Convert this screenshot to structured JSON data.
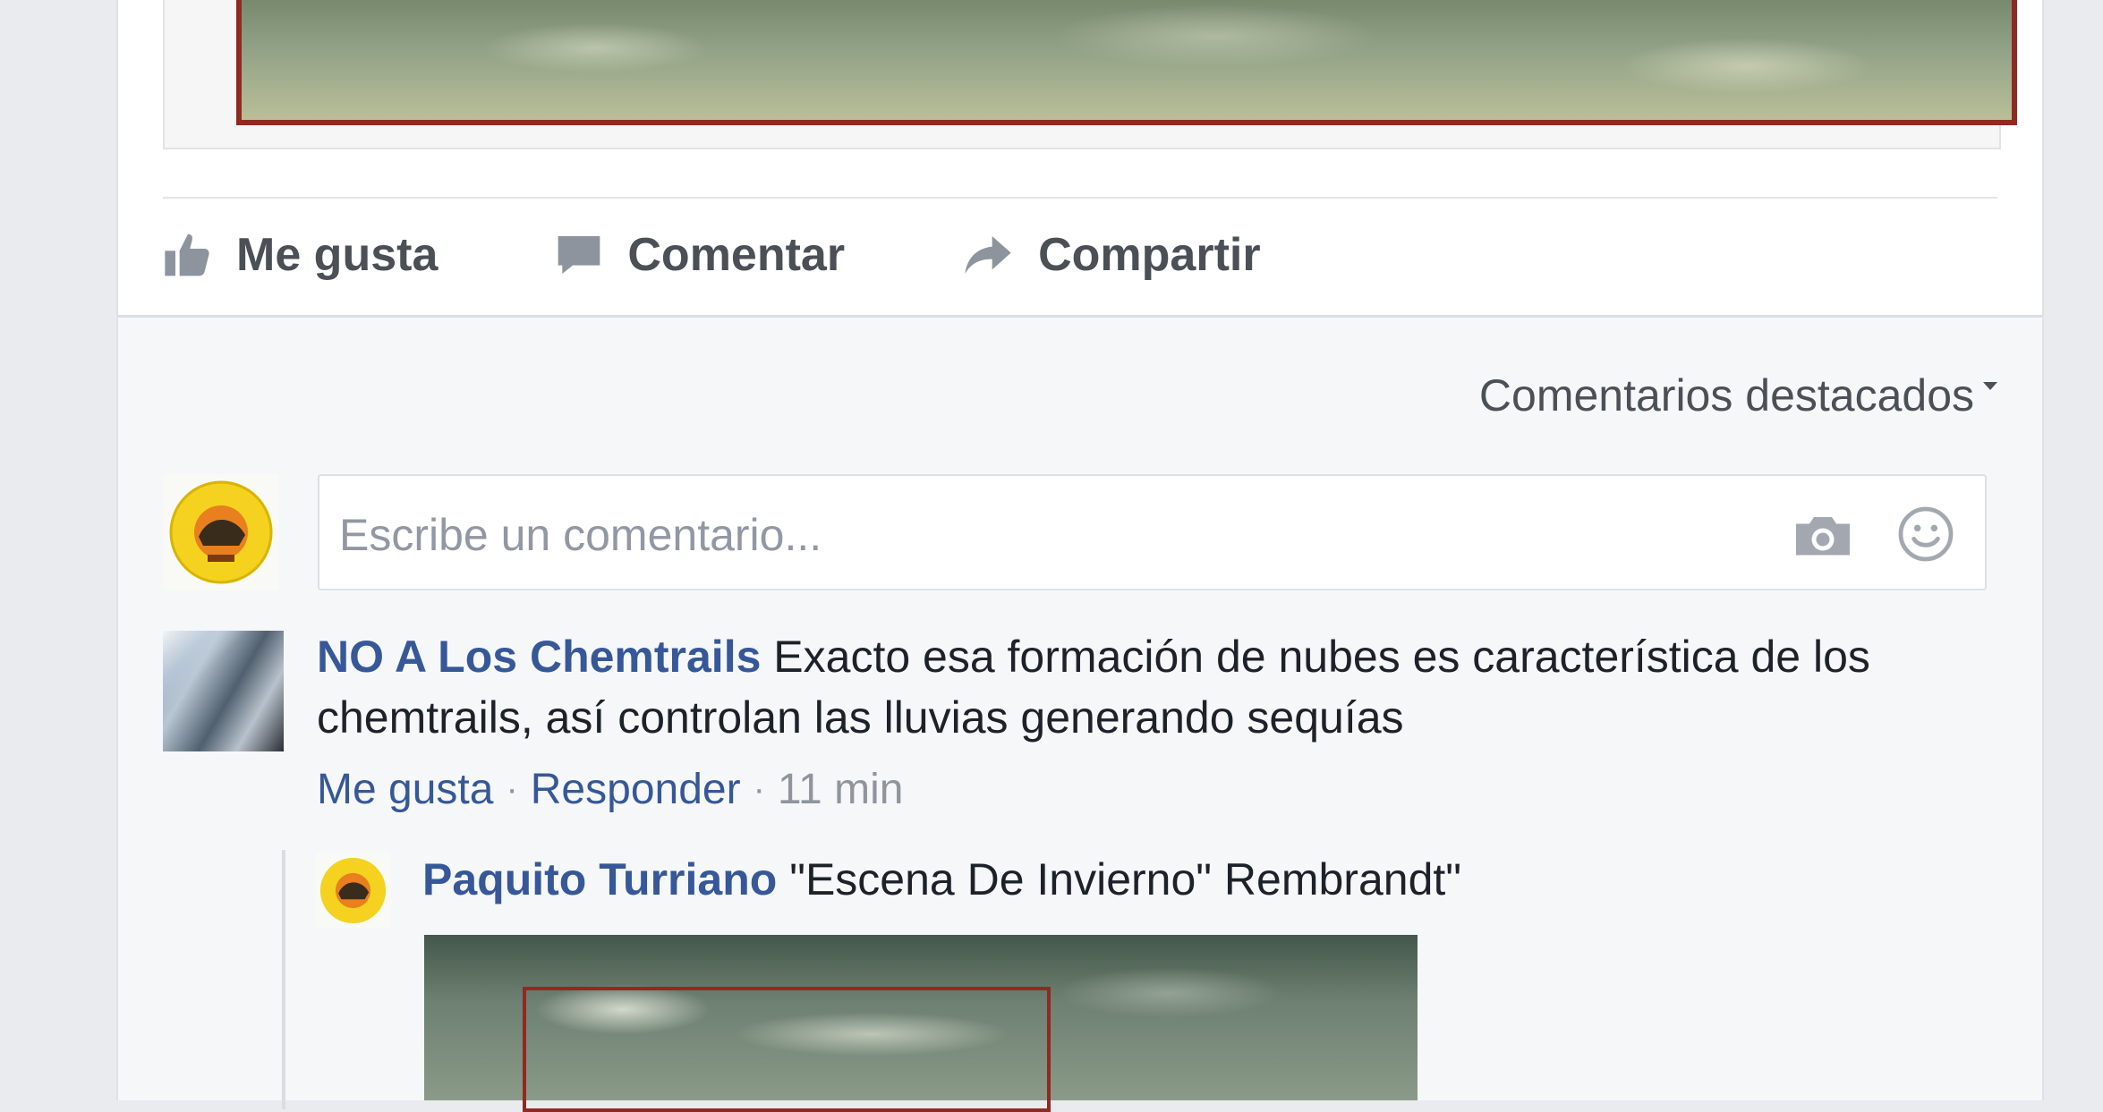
{
  "actions": {
    "like_label": "Me gusta",
    "comment_label": "Comentar",
    "share_label": "Compartir"
  },
  "comments_sort": {
    "label": "Comentarios destacados"
  },
  "composer": {
    "placeholder": "Escribe un comentario..."
  },
  "comment": {
    "author": "NO A Los Chemtrails",
    "text": " Exacto esa formación de nubes es característica de los chemtrails, así controlan las lluvias generando sequías",
    "like_label": "Me gusta",
    "reply_label": "Responder",
    "separator": "·",
    "time": "11 min"
  },
  "reply": {
    "author": "Paquito Turriano",
    "text": " \"Escena De Invierno\" Rembrandt\""
  },
  "colors": {
    "link": "#365899",
    "frame_red": "#8e2a22",
    "avatar_yellow": "#f4d21f"
  }
}
